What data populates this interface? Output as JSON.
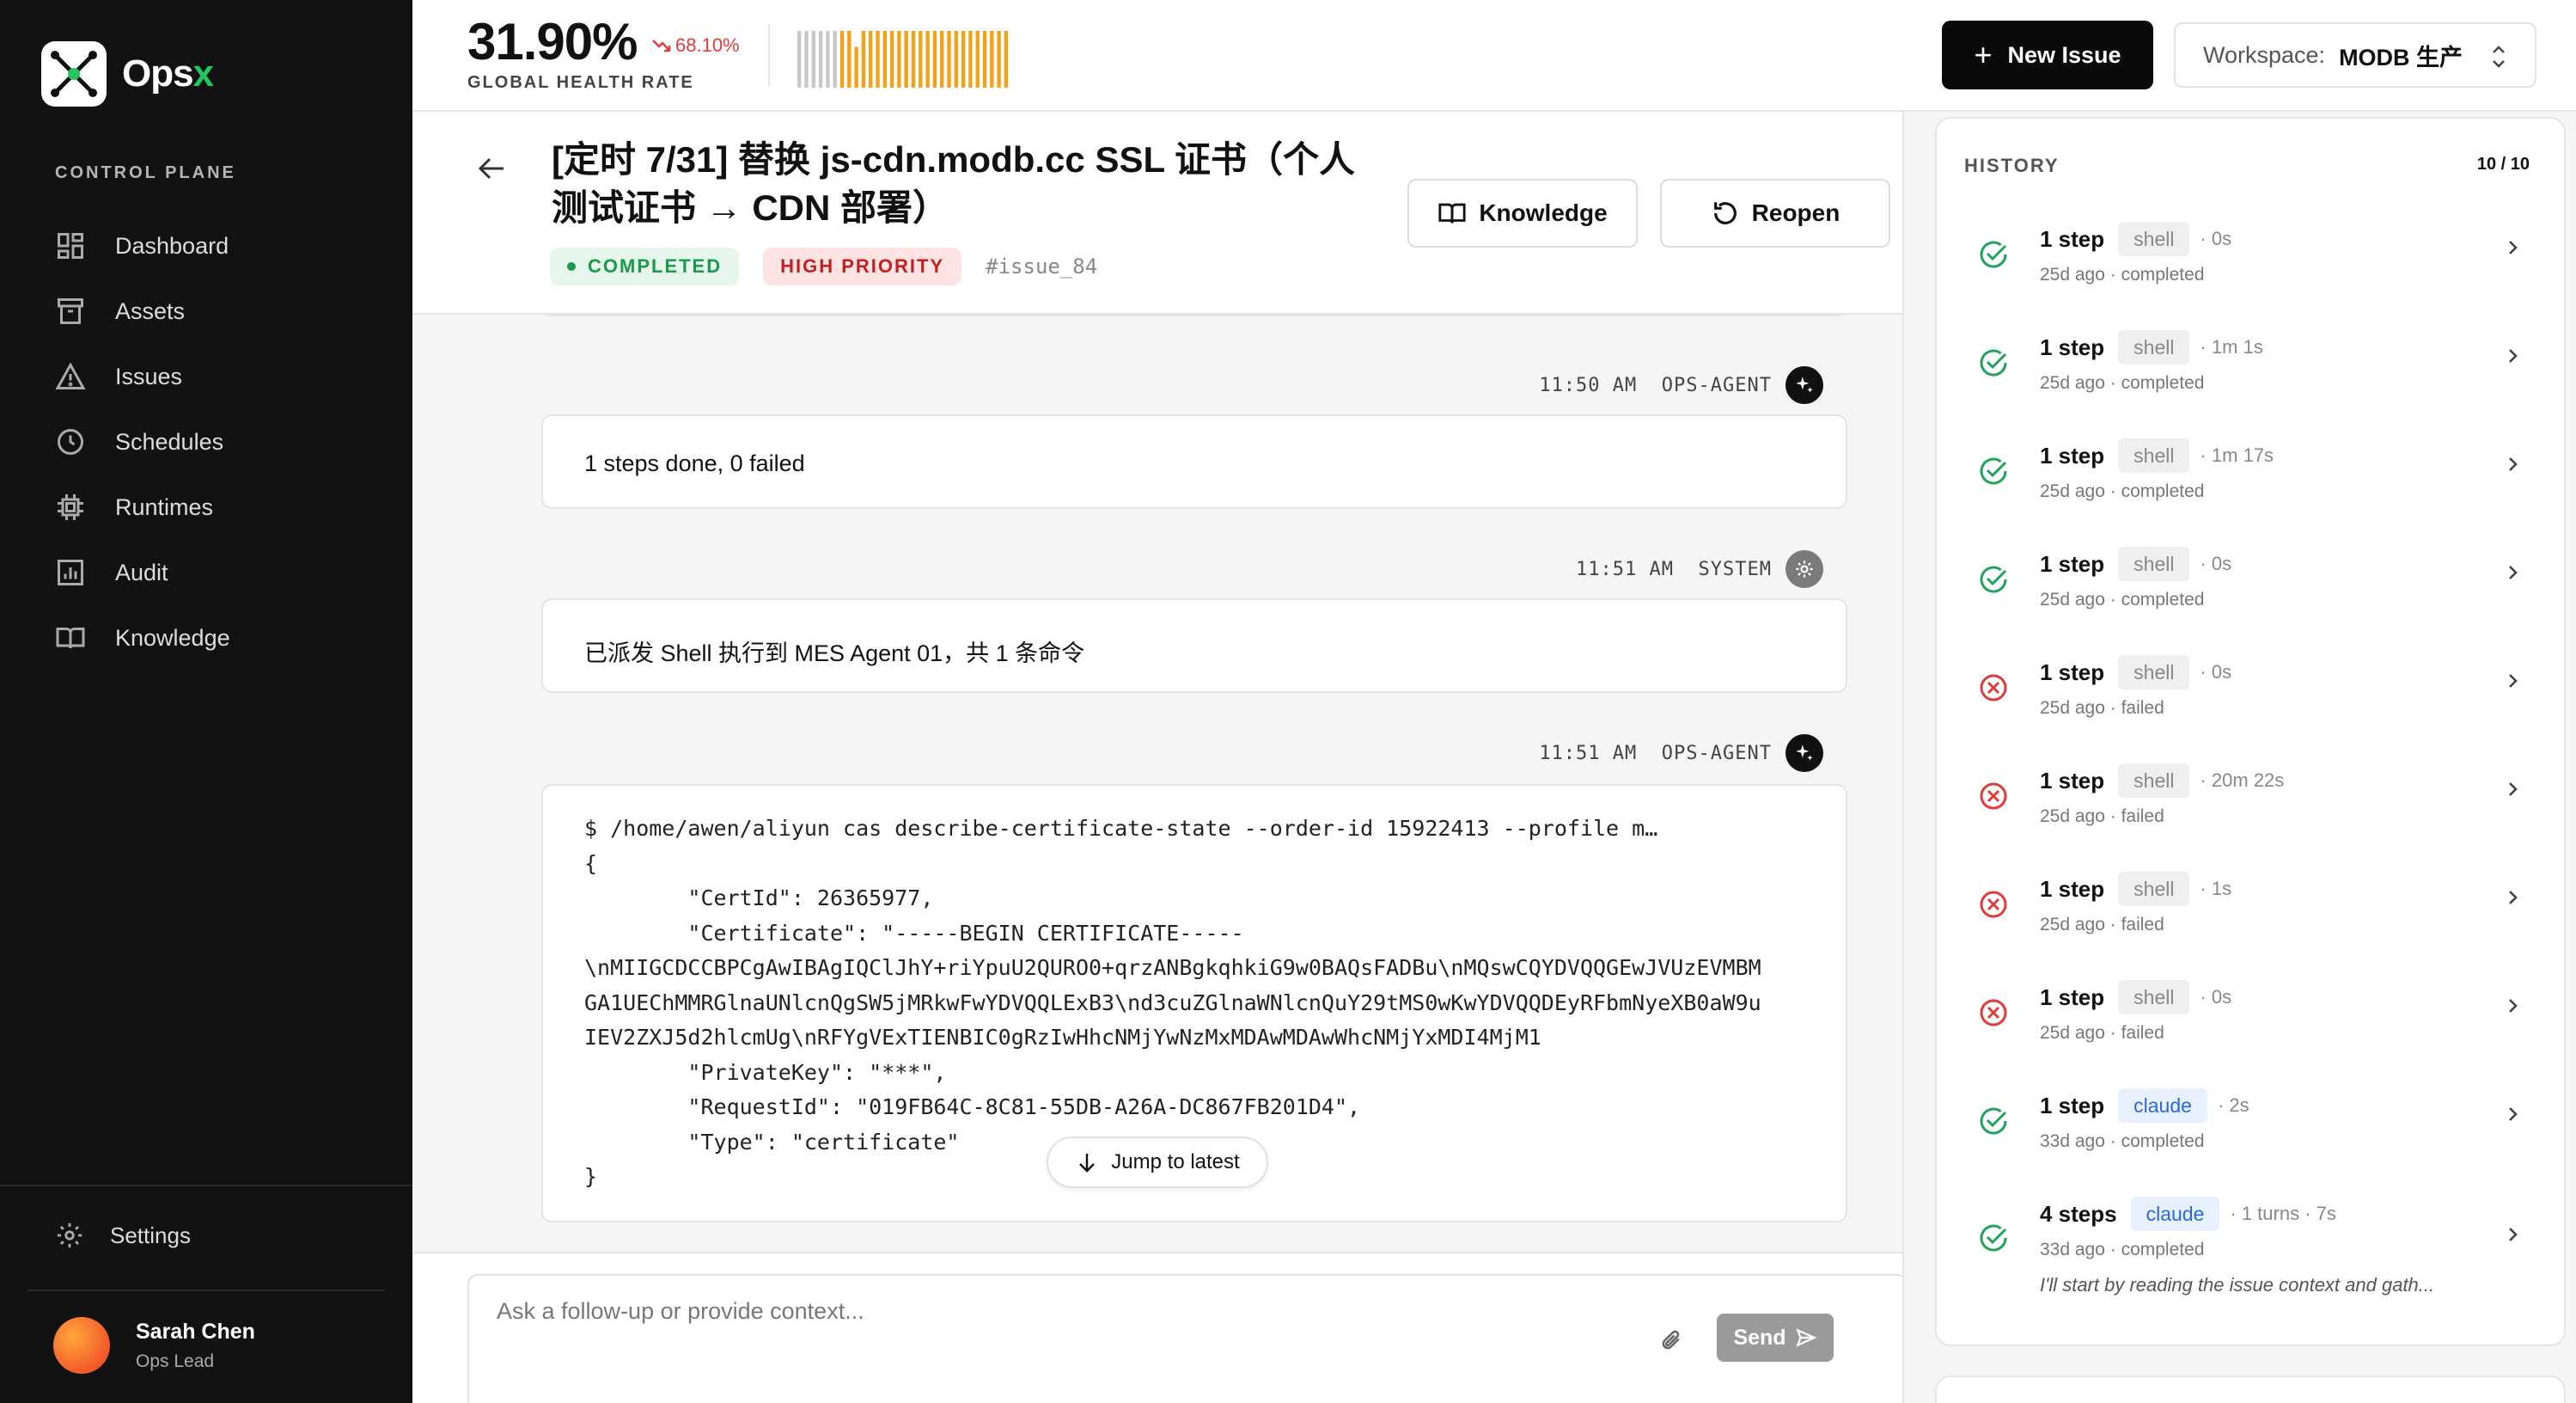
{
  "app": {
    "name_main": "Ops",
    "name_accent": "x"
  },
  "sidebar": {
    "section_label": "CONTROL PLANE",
    "items": [
      {
        "label": "Dashboard",
        "icon": "dashboard-icon"
      },
      {
        "label": "Assets",
        "icon": "archive-icon"
      },
      {
        "label": "Issues",
        "icon": "warning-icon"
      },
      {
        "label": "Schedules",
        "icon": "clock-icon"
      },
      {
        "label": "Runtimes",
        "icon": "cpu-icon"
      },
      {
        "label": "Audit",
        "icon": "chart-icon"
      },
      {
        "label": "Knowledge",
        "icon": "book-icon"
      }
    ],
    "settings_label": "Settings",
    "user": {
      "name": "Sarah Chen",
      "role": "Ops Lead"
    }
  },
  "topbar": {
    "health_value": "31.90%",
    "health_label": "GLOBAL HEALTH RATE",
    "health_delta": "68.10%",
    "sparkline": [
      1,
      1,
      1,
      1,
      1,
      1,
      1,
      1,
      0.72,
      1,
      1,
      1,
      1,
      1,
      1,
      1,
      1,
      1,
      1,
      1,
      1,
      1,
      1,
      1,
      1,
      1,
      1,
      1,
      1,
      1
    ],
    "sparkline_colors": {
      "gray": "#c8c8c8",
      "orange": "#f0a21a"
    },
    "new_issue_label": "New Issue",
    "workspace_label": "Workspace:",
    "workspace_value": "MODB 生产"
  },
  "issue": {
    "title": "[定时 7/31] 替换 js-cdn.modb.cc SSL 证书（个人测试证书 → CDN 部署）",
    "status": "COMPLETED",
    "priority": "HIGH PRIORITY",
    "id": "#issue_84",
    "knowledge_label": "Knowledge",
    "reopen_label": "Reopen"
  },
  "feed": {
    "messages": [
      {
        "time": "11:50 AM",
        "author": "OPS-AGENT",
        "text": "1 steps done, 0 failed"
      },
      {
        "time": "11:51 AM",
        "author": "SYSTEM",
        "text": "已派发 Shell 执行到 MES Agent 01，共 1 条命令"
      },
      {
        "time": "11:51 AM",
        "author": "OPS-AGENT",
        "code": "$ /home/awen/aliyun cas describe-certificate-state --order-id 15922413 --profile m…\n{\n        \"CertId\": 26365977,\n        \"Certificate\": \"-----BEGIN CERTIFICATE-----\n\\nMIIGCDCCBPCgAwIBAgIQClJhY+riYpuU2QURO0+qrzANBgkqhkiG9w0BAQsFADBu\\nMQswCQYDVQQGEwJVUzEVMBM\nGA1UEChMMRGlnaUNlcnQgSW5jMRkwFwYDVQQLExB3\\nd3cuZGlnaWNlcnQuY29tMS0wKwYDVQQDEyRFbmNyeXB0aW9u\nIEV2ZXJ5d2hlcmUg\\nRFYgVExTIENBIC0gRzIwHhcNMjYwNzMxMDAwMDAwWhcNMjYxMDI4MjM1\n        \"PrivateKey\": \"***\",\n        \"RequestId\": \"019FB64C-8C81-55DB-A26A-DC867FB201D4\",\n        \"Type\": \"certificate\"\n}"
      }
    ],
    "jump_label": "Jump to latest"
  },
  "composer": {
    "placeholder": "Ask a follow-up or provide context...",
    "send_label": "Send"
  },
  "history": {
    "title": "HISTORY",
    "count": "10 / 10",
    "items": [
      {
        "steps": "1 step",
        "tool": "shell",
        "extra": "· 0s",
        "meta": "25d ago · completed",
        "status": "ok"
      },
      {
        "steps": "1 step",
        "tool": "shell",
        "extra": "· 1m 1s",
        "meta": "25d ago · completed",
        "status": "ok"
      },
      {
        "steps": "1 step",
        "tool": "shell",
        "extra": "· 1m 17s",
        "meta": "25d ago · completed",
        "status": "ok"
      },
      {
        "steps": "1 step",
        "tool": "shell",
        "extra": "· 0s",
        "meta": "25d ago · completed",
        "status": "ok"
      },
      {
        "steps": "1 step",
        "tool": "shell",
        "extra": "· 0s",
        "meta": "25d ago · failed",
        "status": "fail"
      },
      {
        "steps": "1 step",
        "tool": "shell",
        "extra": "· 20m 22s",
        "meta": "25d ago · failed",
        "status": "fail"
      },
      {
        "steps": "1 step",
        "tool": "shell",
        "extra": "· 1s",
        "meta": "25d ago · failed",
        "status": "fail"
      },
      {
        "steps": "1 step",
        "tool": "shell",
        "extra": "· 0s",
        "meta": "25d ago · failed",
        "status": "fail"
      },
      {
        "steps": "1 step",
        "tool": "claude",
        "extra": "· 2s",
        "meta": "33d ago · completed",
        "status": "ok"
      },
      {
        "steps": "4 steps",
        "tool": "claude",
        "extra": "· 1 turns · 7s",
        "meta": "33d ago · completed",
        "status": "ok",
        "preview": "I'll start by reading the issue context and gath..."
      }
    ],
    "colors": {
      "ok": "#1fa35a",
      "fail": "#e03a3a"
    }
  }
}
